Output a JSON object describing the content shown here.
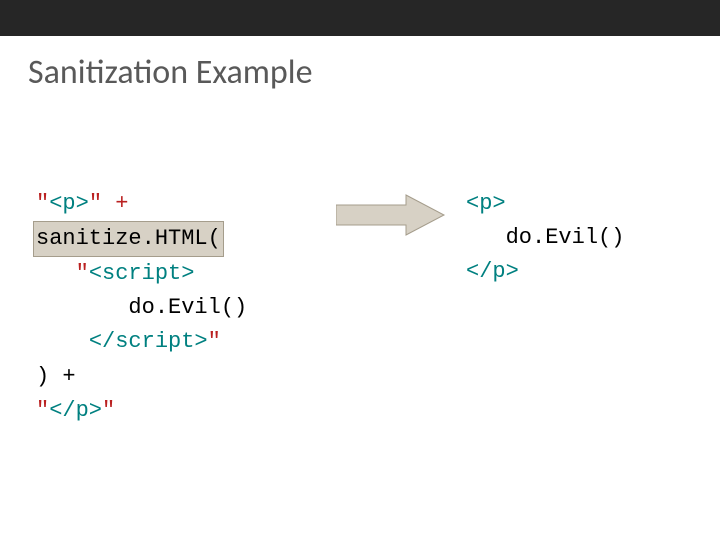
{
  "title": "Sanitization Example",
  "left": {
    "l1a": "\"",
    "l1b": "<p>",
    "l1c": "\" +",
    "l2": "sanitize.HTML(",
    "l3a": "   \"",
    "l3b": "<script>",
    "l4": "       do.Evil()",
    "l5a": "    ",
    "l5b": "</script>",
    "l5c": "\"",
    "l6": ") +",
    "l7a": "\"",
    "l7b": "</p>",
    "l7c": "\""
  },
  "right": {
    "r1": "<p>",
    "r2": "   do.Evil()",
    "r3": "</p>"
  }
}
